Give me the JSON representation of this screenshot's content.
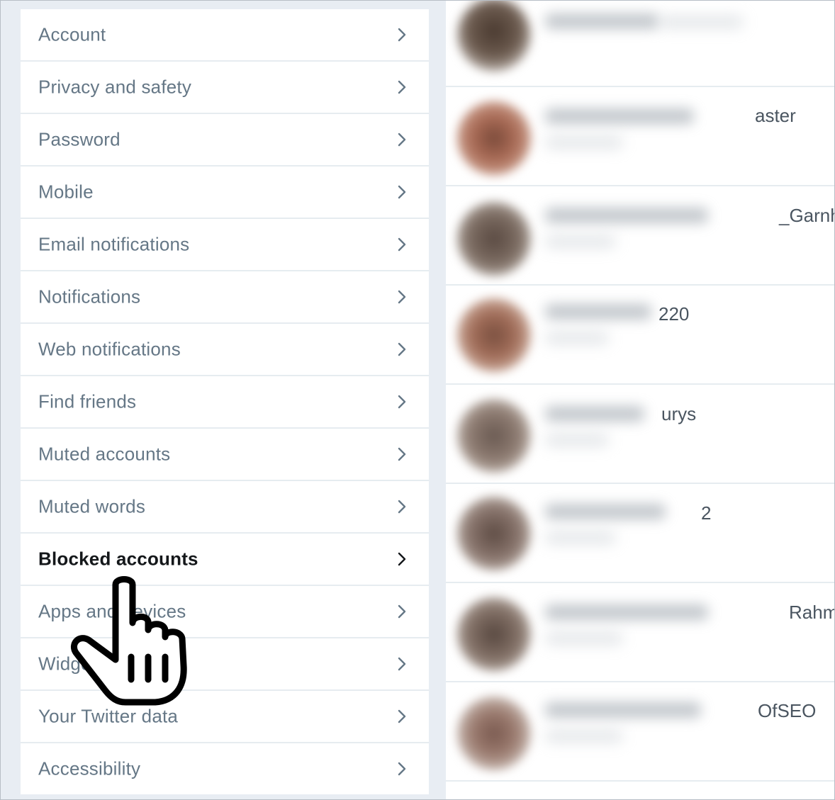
{
  "settings_menu": {
    "items": [
      {
        "label": "Account",
        "active": false
      },
      {
        "label": "Privacy and safety",
        "active": false
      },
      {
        "label": "Password",
        "active": false
      },
      {
        "label": "Mobile",
        "active": false
      },
      {
        "label": "Email notifications",
        "active": false
      },
      {
        "label": "Notifications",
        "active": false
      },
      {
        "label": "Web notifications",
        "active": false
      },
      {
        "label": "Find friends",
        "active": false
      },
      {
        "label": "Muted accounts",
        "active": false
      },
      {
        "label": "Muted words",
        "active": false
      },
      {
        "label": "Blocked accounts",
        "active": true
      },
      {
        "label": "Apps and devices",
        "active": false
      },
      {
        "label": "Widgets",
        "active": false
      },
      {
        "label": "Your Twitter data",
        "active": false
      },
      {
        "label": "Accessibility",
        "active": false
      }
    ]
  },
  "blocked_accounts": [
    {
      "visible_name_suffix": ""
    },
    {
      "visible_name_suffix": "aster"
    },
    {
      "visible_name_suffix": "_Garnh"
    },
    {
      "visible_name_suffix": "220"
    },
    {
      "visible_name_suffix": "urys"
    },
    {
      "visible_name_suffix": "2"
    },
    {
      "visible_name_suffix": "Rahm"
    },
    {
      "visible_name_suffix": "OfSEO"
    }
  ],
  "colors": {
    "menu_text": "#657786",
    "menu_text_active": "#14171a",
    "background": "#e6ecf0"
  },
  "icons": {
    "chevron": "chevron-right-icon",
    "cursor": "hand-pointer-icon"
  }
}
